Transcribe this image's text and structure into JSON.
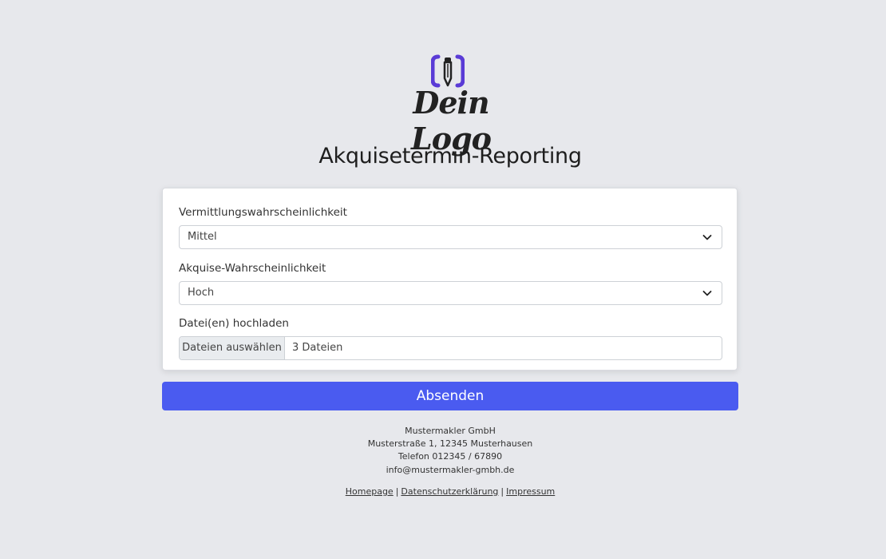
{
  "logo": {
    "text": "Dein Logo",
    "accent_color": "#5a3bd6"
  },
  "page": {
    "title": "Akquisetermin-Reporting"
  },
  "form": {
    "fields": [
      {
        "label": "Vermittlungswahrscheinlichkeit",
        "value": "Mittel",
        "icon": "chevron-down-icon"
      },
      {
        "label": "Akquise-Wahrscheinlichkeit",
        "value": "Hoch",
        "icon": "chevron-down-icon"
      }
    ],
    "upload": {
      "label": "Datei(en) hochladen",
      "button": "Dateien auswählen",
      "status": "3 Dateien"
    },
    "submit_label": "Absenden",
    "submit_color": "#4a5bf0"
  },
  "footer": {
    "company": "Mustermakler GmbH",
    "address": "Musterstraße 1, 12345 Musterhausen",
    "phone": "Telefon 012345 / 67890",
    "email": "info@mustermakler-gmbh.de",
    "links": [
      "Homepage",
      "Datenschutzerklärung",
      "Impressum"
    ],
    "separator": "|"
  }
}
